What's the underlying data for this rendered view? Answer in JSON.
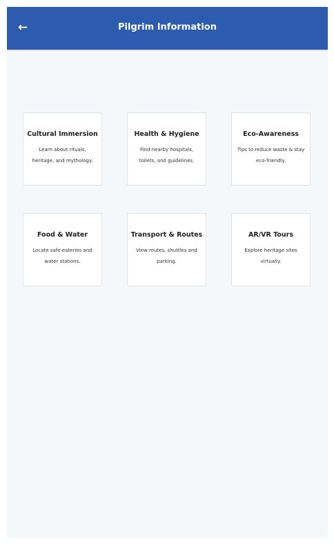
{
  "header": {
    "back_icon": "←",
    "title": "Pilgrim Information"
  },
  "cards": [
    {
      "title": "Cultural Immersion",
      "desc": "Learn about rituals, heritage, and mythology."
    },
    {
      "title": "Health & Hygiene",
      "desc": "Find nearby hospitals, toilets, and guidelines."
    },
    {
      "title": "Eco-Awareness",
      "desc": "Tips to reduce waste & stay eco-friendly."
    },
    {
      "title": "Food & Water",
      "desc": "Locate safe eateries and water stations."
    },
    {
      "title": "Transport & Routes",
      "desc": "View routes, shuttles and parking."
    },
    {
      "title": "AR/VR Tours",
      "desc": "Explore heritage sites virtually."
    }
  ],
  "colors": {
    "header_bg": "#2d5bae",
    "page_bg": "#f5f8fb",
    "card_bg": "#ffffff"
  }
}
